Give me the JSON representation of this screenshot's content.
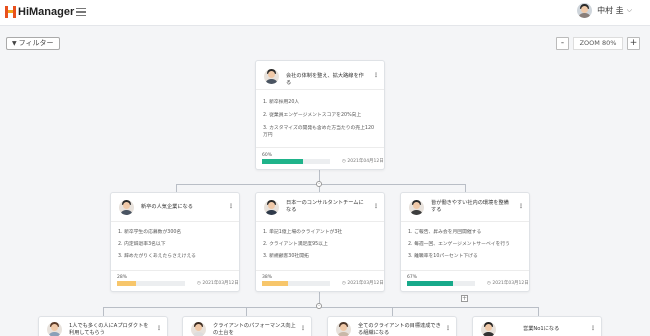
{
  "header": {
    "app_name": "HiManager",
    "user_name": "中村 圭",
    "chevron": "⌵"
  },
  "toolbar": {
    "filter_label": "フィルター",
    "zoom_minus": "-",
    "zoom_label": "ZOOM 80%",
    "zoom_plus": "+"
  },
  "colors": {
    "green": "#1fb38a",
    "yellow": "#f7c66b",
    "teal": "#17a98a"
  },
  "root": {
    "title": "会社の体制を整え、拡大路線を作る",
    "krs": [
      "1. 新卒採用20人",
      "2. 従業員エンゲージメントスコアを20%向上",
      "3. カスタマイズの開発も含めた方当たりの売上120万円"
    ],
    "progress_label": "60%",
    "progress": 0.6,
    "date": "2021年04月12日"
  },
  "level2": [
    {
      "title": "新卒の人気企業になる",
      "krs": [
        "1. 新卒学生の応募数が300名",
        "2. 内定辞退率3名以下",
        "3. 辞めたがりくあえたらさえけえる"
      ],
      "progress_label": "28%",
      "progress": 0.28,
      "date": "2021年03月12日"
    },
    {
      "title": "日本一のコンサルタントチームになる",
      "krs": [
        "1. 単記1億上場のクライアントが3社",
        "2. クライアント満足度95以上",
        "3. 新規顧客30社開拓"
      ],
      "progress_label": "38%",
      "progress": 0.38,
      "date": "2021年03月12日"
    },
    {
      "title": "皆が働きやすい社内の環境を整備する",
      "krs": [
        "1. ご報告、昇み会を月回開催する",
        "2. 毎週一回、エンゲージメントサーベイを行う",
        "3. 離職率を10パーセント下げる"
      ],
      "progress_label": "67%",
      "progress": 0.67,
      "date": "2021年03月12日"
    }
  ],
  "level3": [
    {
      "title": "1人でも多くの人にAプロダクトを利用してもらう"
    },
    {
      "title": "クライアントのパフォーマンス向上の土台を"
    },
    {
      "title": "全てのクライアントの目標達成できる組織になる"
    },
    {
      "title": "営業No1になる"
    }
  ],
  "icons": {
    "filter": "▼",
    "menu": "⋮",
    "clock": "◷",
    "collapse": "-",
    "expand": "+"
  }
}
